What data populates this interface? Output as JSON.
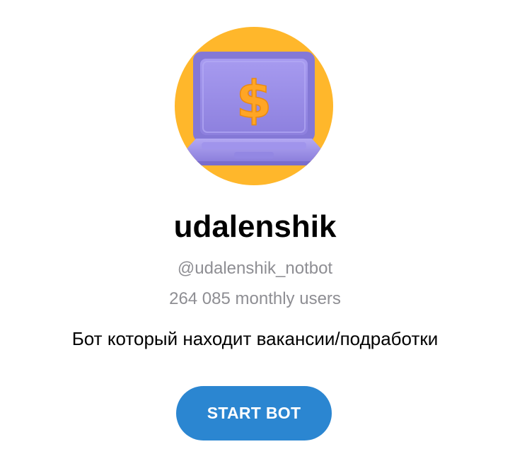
{
  "bot": {
    "name": "udalenshik",
    "username": "@udalenshik_notbot",
    "monthly_users": "264 085 monthly users",
    "description": "Бот который находит вакансии/подработки"
  },
  "start_button": {
    "label": "START BOT"
  },
  "avatar": {
    "icon": "laptop-dollar-icon",
    "symbol": "$"
  },
  "colors": {
    "accent": "#2b86d1",
    "avatar_background": "#ffb72b",
    "laptop": "#9a8de6",
    "dollar": "#ffa524"
  }
}
